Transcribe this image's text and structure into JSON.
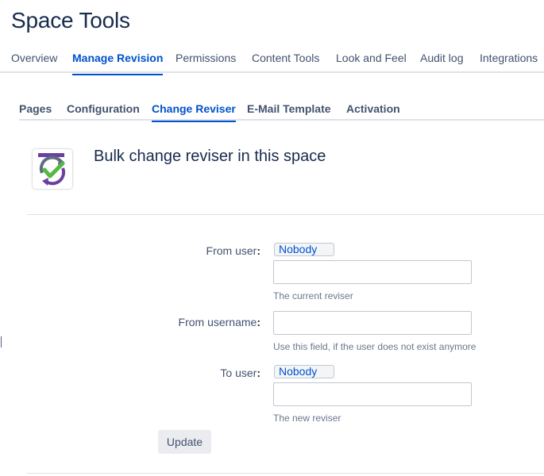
{
  "page": {
    "title": "Space Tools"
  },
  "main_tabs": [
    {
      "label": "Overview",
      "active": false
    },
    {
      "label": "Manage Revision",
      "active": true
    },
    {
      "label": "Permissions",
      "active": false
    },
    {
      "label": "Content Tools",
      "active": false
    },
    {
      "label": "Look and Feel",
      "active": false
    },
    {
      "label": "Audit log",
      "active": false
    },
    {
      "label": "Integrations",
      "active": false
    }
  ],
  "sub_tabs": [
    {
      "label": "Pages",
      "active": false
    },
    {
      "label": "Configuration",
      "active": false
    },
    {
      "label": "Change Reviser",
      "active": true
    },
    {
      "label": "E-Mail Template",
      "active": false
    },
    {
      "label": "Activation",
      "active": false
    }
  ],
  "section": {
    "logo_icon": "revision-app-logo-icon",
    "heading": "Bulk change reviser in this space"
  },
  "form": {
    "from_user": {
      "label": "From user",
      "colon": ":",
      "chip": "Nobody",
      "value": "",
      "hint": "The current reviser"
    },
    "from_username": {
      "label": "From username",
      "colon": ":",
      "value": "",
      "hint": "Use this field, if the user does not exist anymore"
    },
    "to_user": {
      "label": "To user",
      "colon": ":",
      "chip": "Nobody",
      "value": "",
      "hint": "The new reviser"
    },
    "submit_label": "Update"
  },
  "colors": {
    "accent": "#0052cc",
    "text": "#172b4d",
    "muted": "#6b778c",
    "border": "#dfe1e6",
    "logo_purple": "#6b3fa0",
    "logo_green": "#57b846",
    "logo_gray": "#5e6c84"
  }
}
